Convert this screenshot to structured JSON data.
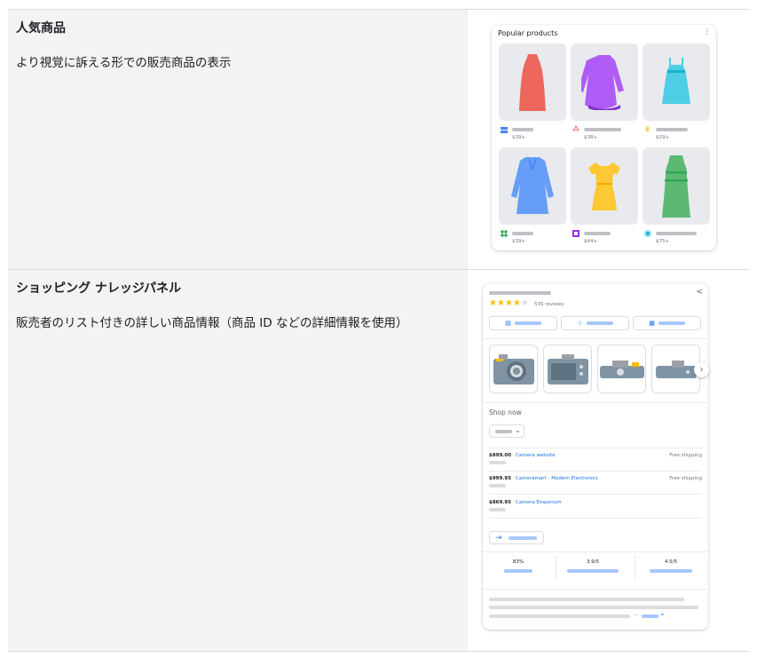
{
  "rows": [
    {
      "title": "人気商品",
      "description": "より視覚に訴える形での販売商品の表示"
    },
    {
      "title": "ショッピング ナレッジパネル",
      "description": "販売者のリスト付きの詳しい商品情報（商品 ID などの詳細情報を使用）"
    }
  ],
  "popular_products": {
    "title": "Popular products",
    "menu_icon": "more-vert-icon",
    "products": [
      {
        "price": "$39+",
        "dress": "red-dress",
        "color": "#ee675c",
        "logo_color": "#4285f4"
      },
      {
        "price": "$38+",
        "dress": "purple-dress",
        "color": "#af5cf7",
        "logo_color": "#ea4335"
      },
      {
        "price": "$29+",
        "dress": "cyan-dress",
        "color": "#4ecde6",
        "logo_color": "#fbbc04"
      },
      {
        "price": "$39+",
        "dress": "blue-coat",
        "color": "#669df6",
        "logo_color": "#34a853"
      },
      {
        "price": "$44+",
        "dress": "yellow-dress",
        "color": "#fcc934",
        "logo_color": "#9334e6"
      },
      {
        "price": "$75+",
        "dress": "green-dress",
        "color": "#5bb974",
        "logo_color": "#12b5cb"
      }
    ]
  },
  "knowledge_panel": {
    "rating_stars": "★★★★",
    "rating_empty_star": "★",
    "reviews": "535 reviews",
    "share_icon": "share-icon",
    "chips": [
      "clipboard-icon",
      "sparkle-star-icon",
      "store-icon"
    ],
    "shop_now": "Shop now",
    "next_icon": "›",
    "sellers": [
      {
        "price": "$899.00",
        "name": "Camera website",
        "shipping": "Free shipping"
      },
      {
        "price": "$999.95",
        "name": "Cameramart - Modern Electronics",
        "shipping": "Free shipping"
      },
      {
        "price": "$869.95",
        "name": "Camera Emporium",
        "shipping": ""
      }
    ],
    "stats": [
      "83%",
      "3.9/5",
      "4.5/5"
    ],
    "ellipsis": "..."
  }
}
